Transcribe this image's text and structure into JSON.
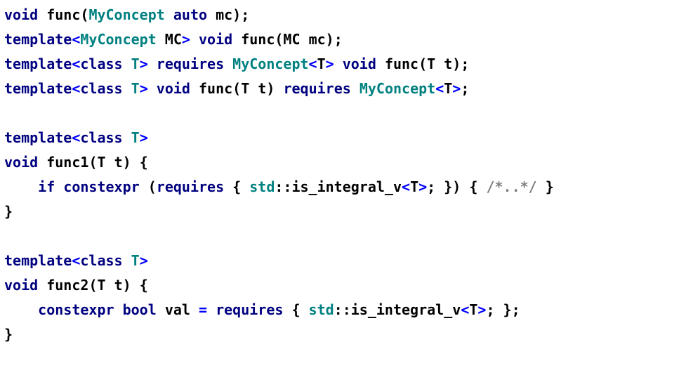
{
  "code": {
    "l1": {
      "kw_void": "void",
      "fn": "func",
      "type": "MyConcept",
      "kw_auto": "auto",
      "p": "mc"
    },
    "l2": {
      "kw_tmpl": "template",
      "type": "MyConcept",
      "tp": "MC",
      "kw_void": "void",
      "fn": "func",
      "p": "mc"
    },
    "l3": {
      "kw_tmpl": "template",
      "kw_class": "class",
      "tp": "T",
      "kw_req": "requires",
      "type": "MyConcept",
      "kw_void": "void",
      "fn": "func",
      "p": "t"
    },
    "l4": {
      "kw_tmpl": "template",
      "kw_class": "class",
      "tp": "T",
      "kw_void": "void",
      "fn": "func",
      "p": "t",
      "kw_req": "requires",
      "type": "MyConcept"
    },
    "l6": {
      "kw_tmpl": "template",
      "kw_class": "class",
      "tp": "T"
    },
    "l7": {
      "kw_void": "void",
      "fn": "func1",
      "tp": "T",
      "p": "t"
    },
    "l8": {
      "kw_if": "if",
      "kw_cexpr": "constexpr",
      "kw_req": "requires",
      "ns": "std",
      "mem": "is_integral_v",
      "tp": "T",
      "comment": "/*..*/"
    },
    "l11": {
      "kw_tmpl": "template",
      "kw_class": "class",
      "tp": "T"
    },
    "l12": {
      "kw_void": "void",
      "fn": "func2",
      "tp": "T",
      "p": "t"
    },
    "l13": {
      "kw_cexpr": "constexpr",
      "kw_bool": "bool",
      "var": "val",
      "kw_req": "requires",
      "ns": "std",
      "mem": "is_integral_v",
      "tp": "T"
    }
  },
  "glyph": {
    "lt": "<",
    "gt": ">",
    "dcolon": "::",
    "eq": "="
  }
}
